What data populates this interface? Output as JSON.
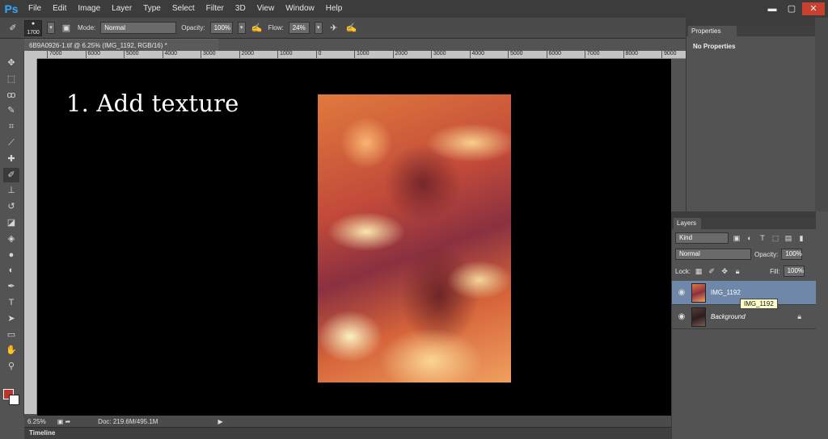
{
  "app": {
    "logo": "Ps"
  },
  "menu": [
    "File",
    "Edit",
    "Image",
    "Layer",
    "Type",
    "Select",
    "Filter",
    "3D",
    "View",
    "Window",
    "Help"
  ],
  "window_controls": {
    "minimize": "▬",
    "maximize": "▢",
    "close": "✕"
  },
  "options": {
    "brush_size": "1700",
    "mode_label": "Mode:",
    "mode_value": "Normal",
    "opacity_label": "Opacity:",
    "opacity_value": "100%",
    "flow_label": "Flow:",
    "flow_value": "24%"
  },
  "document": {
    "tab_title": "6B9A0926-1.tif @ 6.25% (IMG_1192, RGB/16) *",
    "caption": "1. Add texture"
  },
  "ruler": {
    "top_ticks": [
      "7000",
      "6000",
      "5000",
      "4000",
      "3000",
      "2000",
      "1000",
      "0",
      "1000",
      "2000",
      "3000",
      "4000",
      "5000",
      "6000",
      "7000",
      "8000",
      "9000"
    ]
  },
  "toolbar": {
    "tools": [
      {
        "name": "move-tool",
        "glyph": "✥"
      },
      {
        "name": "marquee-tool",
        "glyph": "⬚"
      },
      {
        "name": "lasso-tool",
        "glyph": "ꝏ"
      },
      {
        "name": "quick-select-tool",
        "glyph": "✎"
      },
      {
        "name": "crop-tool",
        "glyph": "⌗"
      },
      {
        "name": "eyedropper-tool",
        "glyph": "⟋"
      },
      {
        "name": "healing-tool",
        "glyph": "✚"
      },
      {
        "name": "brush-tool",
        "glyph": "✐"
      },
      {
        "name": "stamp-tool",
        "glyph": "⊥"
      },
      {
        "name": "history-brush-tool",
        "glyph": "↺"
      },
      {
        "name": "eraser-tool",
        "glyph": "◪"
      },
      {
        "name": "paint-bucket-tool",
        "glyph": "◈"
      },
      {
        "name": "blur-tool",
        "glyph": "●"
      },
      {
        "name": "dodge-tool",
        "glyph": "◐"
      },
      {
        "name": "pen-tool",
        "glyph": "✒"
      },
      {
        "name": "type-tool",
        "glyph": "T"
      },
      {
        "name": "path-select-tool",
        "glyph": "➤"
      },
      {
        "name": "shape-tool",
        "glyph": "▭"
      },
      {
        "name": "hand-tool",
        "glyph": "✋"
      },
      {
        "name": "zoom-tool",
        "glyph": "⚲"
      }
    ],
    "foreground_color": "#c4302b",
    "background_color": "#ffffff"
  },
  "status": {
    "zoom": "6.25%",
    "doc_info": "Doc: 219.6M/495.1M"
  },
  "timeline": {
    "label": "Timeline"
  },
  "properties": {
    "tab": "Properties",
    "empty_text": "No Properties"
  },
  "layers": {
    "tab": "Layers",
    "filter_kind": "Kind",
    "blend_mode": "Normal",
    "opacity_label": "Opacity:",
    "opacity_value": "100%",
    "lock_label": "Lock:",
    "fill_label": "Fill:",
    "fill_value": "100%",
    "items": [
      {
        "name": "IMG_1192",
        "selected": true
      },
      {
        "name": "Background",
        "selected": false,
        "locked": true
      }
    ],
    "tooltip": "IMG_1192"
  },
  "colors": {
    "selection": "#6f87a8",
    "accent": "#31a8ff"
  }
}
